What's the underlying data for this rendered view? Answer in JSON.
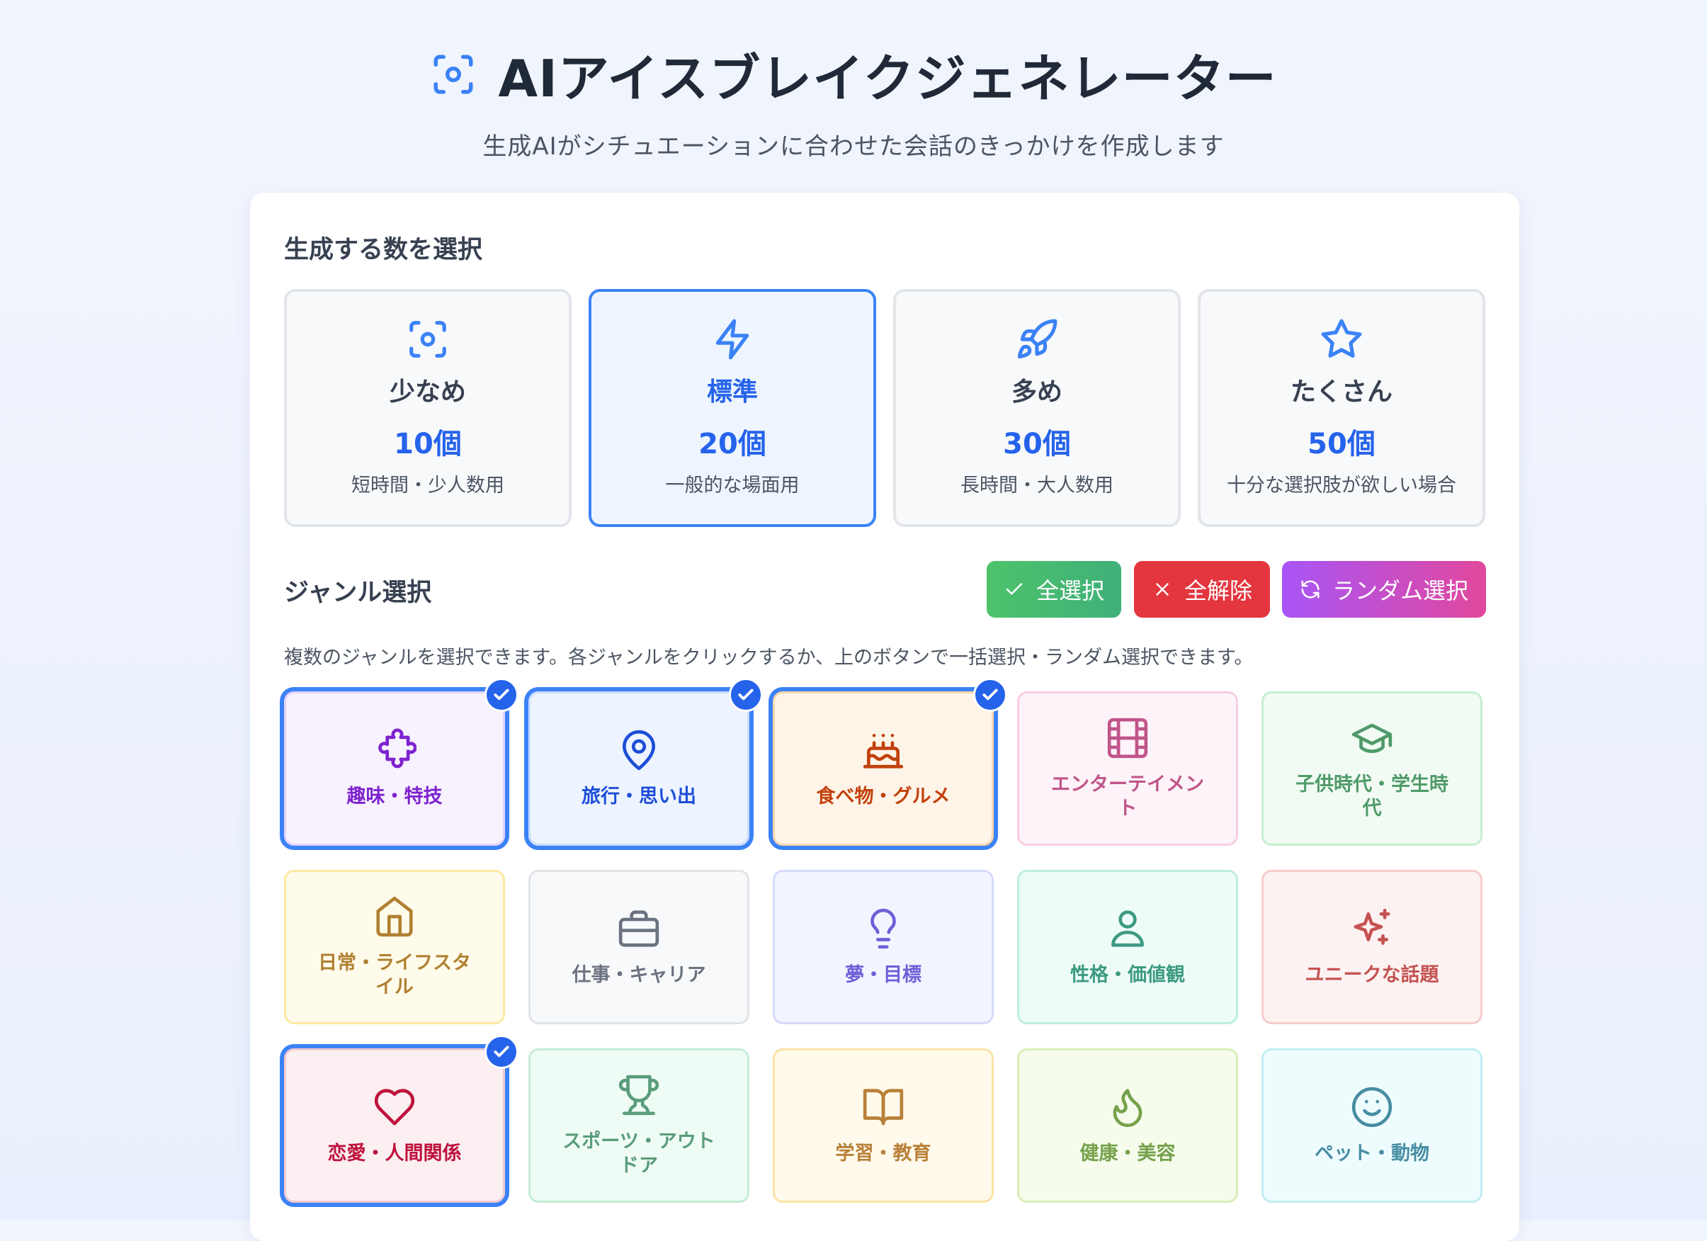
{
  "header": {
    "title": "AIアイスブレイクジェネレーター",
    "subtitle": "生成AIがシチュエーションに合わせた会話のきっかけを作成します",
    "icon": "focus-icon"
  },
  "count_section": {
    "title": "生成する数を選択",
    "options": [
      {
        "label": "少なめ",
        "value": "10個",
        "desc": "短時間・少人数用",
        "icon": "focus-icon",
        "selected": false
      },
      {
        "label": "標準",
        "value": "20個",
        "desc": "一般的な場面用",
        "icon": "lightning-icon",
        "selected": true
      },
      {
        "label": "多め",
        "value": "30個",
        "desc": "長時間・大人数用",
        "icon": "rocket-icon",
        "selected": false
      },
      {
        "label": "たくさん",
        "value": "50個",
        "desc": "十分な選択肢が欲しい場合",
        "icon": "star-icon",
        "selected": false
      }
    ]
  },
  "genre_section": {
    "title": "ジャンル選択",
    "help": "複数のジャンルを選択できます。各ジャンルをクリックするか、上のボタンで一括選択・ランダム選択できます。",
    "buttons": {
      "select_all": "全選択",
      "clear_all": "全解除",
      "random": "ランダム選択"
    },
    "genres": [
      {
        "label": "趣味・特技",
        "icon": "puzzle-icon",
        "selected": true,
        "color": "#7e22ce"
      },
      {
        "label": "旅行・思い出",
        "icon": "map-pin-icon",
        "selected": true,
        "color": "#1d4ed8"
      },
      {
        "label": "食べ物・グルメ",
        "icon": "cake-icon",
        "selected": true,
        "color": "#c2410c"
      },
      {
        "label": "エンターテイメント",
        "icon": "film-icon",
        "selected": false,
        "color": "#c0558a"
      },
      {
        "label": "子供時代・学生時代",
        "icon": "graduation-cap-icon",
        "selected": false,
        "color": "#4f9a69"
      },
      {
        "label": "日常・ライフスタイル",
        "icon": "home-icon",
        "selected": false,
        "color": "#b08031"
      },
      {
        "label": "仕事・キャリア",
        "icon": "briefcase-icon",
        "selected": false,
        "color": "#6b7280"
      },
      {
        "label": "夢・目標",
        "icon": "lightbulb-icon",
        "selected": false,
        "color": "#6d60d8"
      },
      {
        "label": "性格・価値観",
        "icon": "user-icon",
        "selected": false,
        "color": "#3d9a82"
      },
      {
        "label": "ユニークな話題",
        "icon": "sparkles-icon",
        "selected": false,
        "color": "#c55252"
      },
      {
        "label": "恋愛・人間関係",
        "icon": "heart-icon",
        "selected": true,
        "color": "#be123c"
      },
      {
        "label": "スポーツ・アウトドア",
        "icon": "trophy-icon",
        "selected": false,
        "color": "#5a9c7b"
      },
      {
        "label": "学習・教育",
        "icon": "book-icon",
        "selected": false,
        "color": "#b98038"
      },
      {
        "label": "健康・美容",
        "icon": "flame-icon",
        "selected": false,
        "color": "#75a14a"
      },
      {
        "label": "ペット・動物",
        "icon": "smile-icon",
        "selected": false,
        "color": "#478da3"
      }
    ]
  }
}
